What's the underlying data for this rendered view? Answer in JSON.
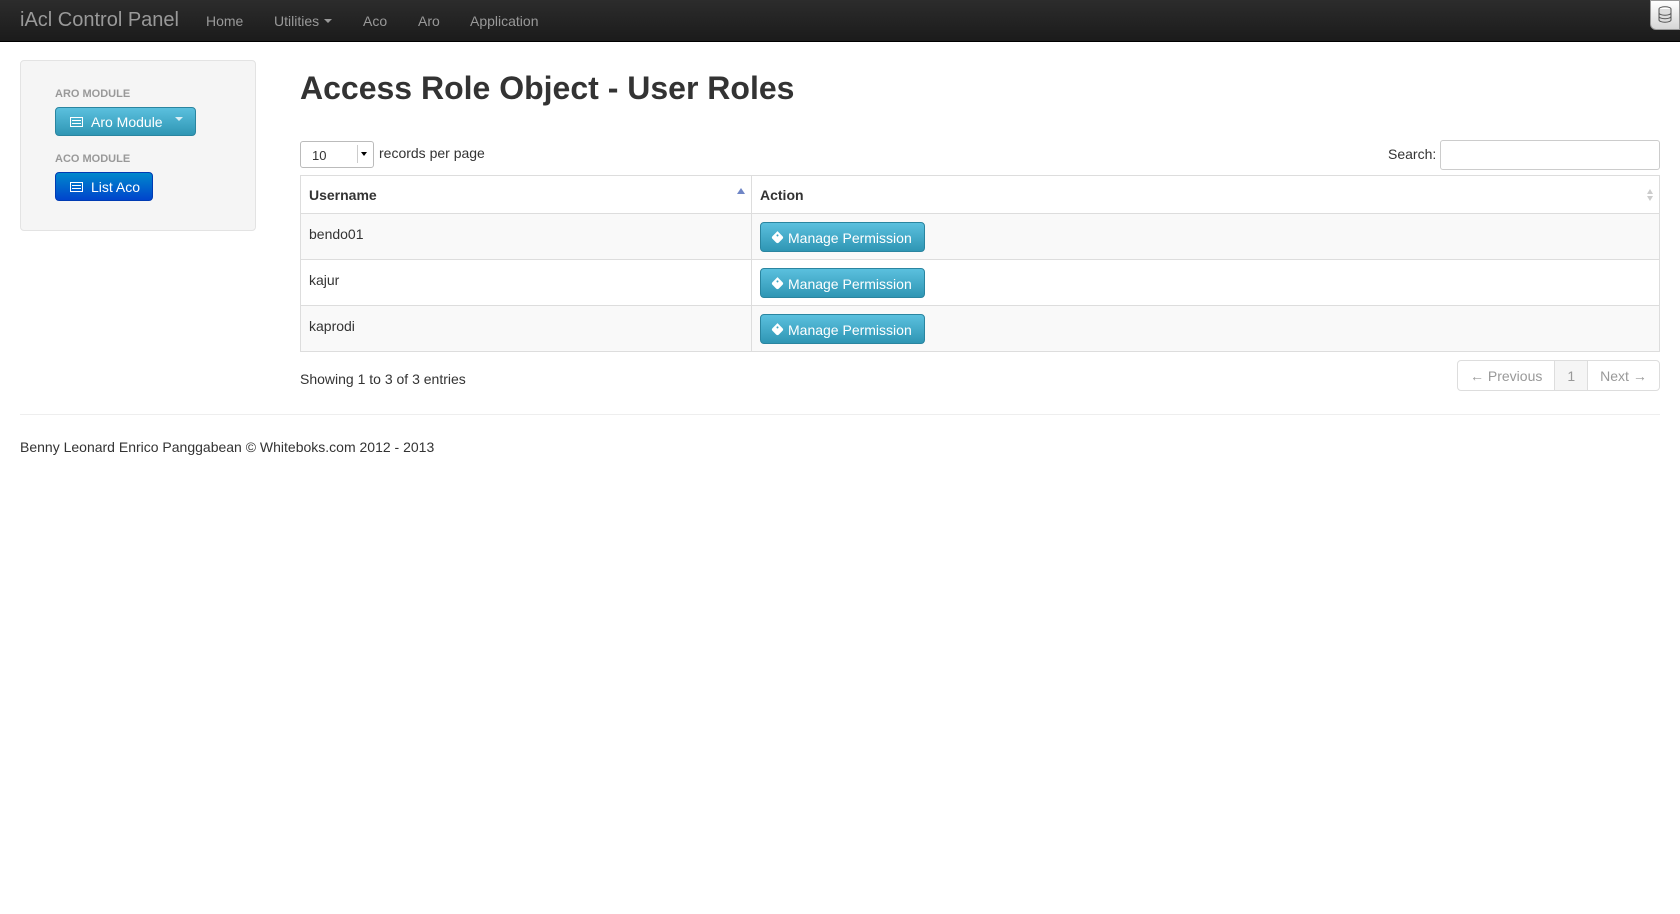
{
  "navbar": {
    "brand": "iAcl Control Panel",
    "items": [
      {
        "label": "Home"
      },
      {
        "label": "Utilities",
        "has_dropdown": true
      },
      {
        "label": "Aco"
      },
      {
        "label": "Aro"
      },
      {
        "label": "Application"
      }
    ],
    "corner_icon": "database-icon"
  },
  "sidebar": {
    "aro_header": "ARO MODULE",
    "aro_button": "Aro Module",
    "aco_header": "ACO MODULE",
    "aco_button": "List Aco",
    "button_icon": "list-icon"
  },
  "main": {
    "title": "Access Role Object - User Roles",
    "length_value": "10",
    "length_label": "records per page",
    "search_label": "Search:",
    "search_value": "",
    "columns": [
      "Username",
      "Action"
    ],
    "rows": [
      {
        "username": "bendo01",
        "action": "Manage Permission"
      },
      {
        "username": "kajur",
        "action": "Manage Permission"
      },
      {
        "username": "kaprodi",
        "action": "Manage Permission"
      }
    ],
    "action_icon": "tag-icon",
    "info": "Showing 1 to 3 of 3 entries",
    "pager": {
      "previous": "← Previous",
      "page": "1",
      "next": "Next →"
    }
  },
  "footer": {
    "text": "Benny Leonard Enrico Panggabean © Whiteboks.com 2012 - 2013"
  },
  "colors": {
    "navbar_bg": "#1b1b1b",
    "info_button": "#2f96b4",
    "primary_button": "#0044cc",
    "sort_arrow": "#6f86c6"
  }
}
